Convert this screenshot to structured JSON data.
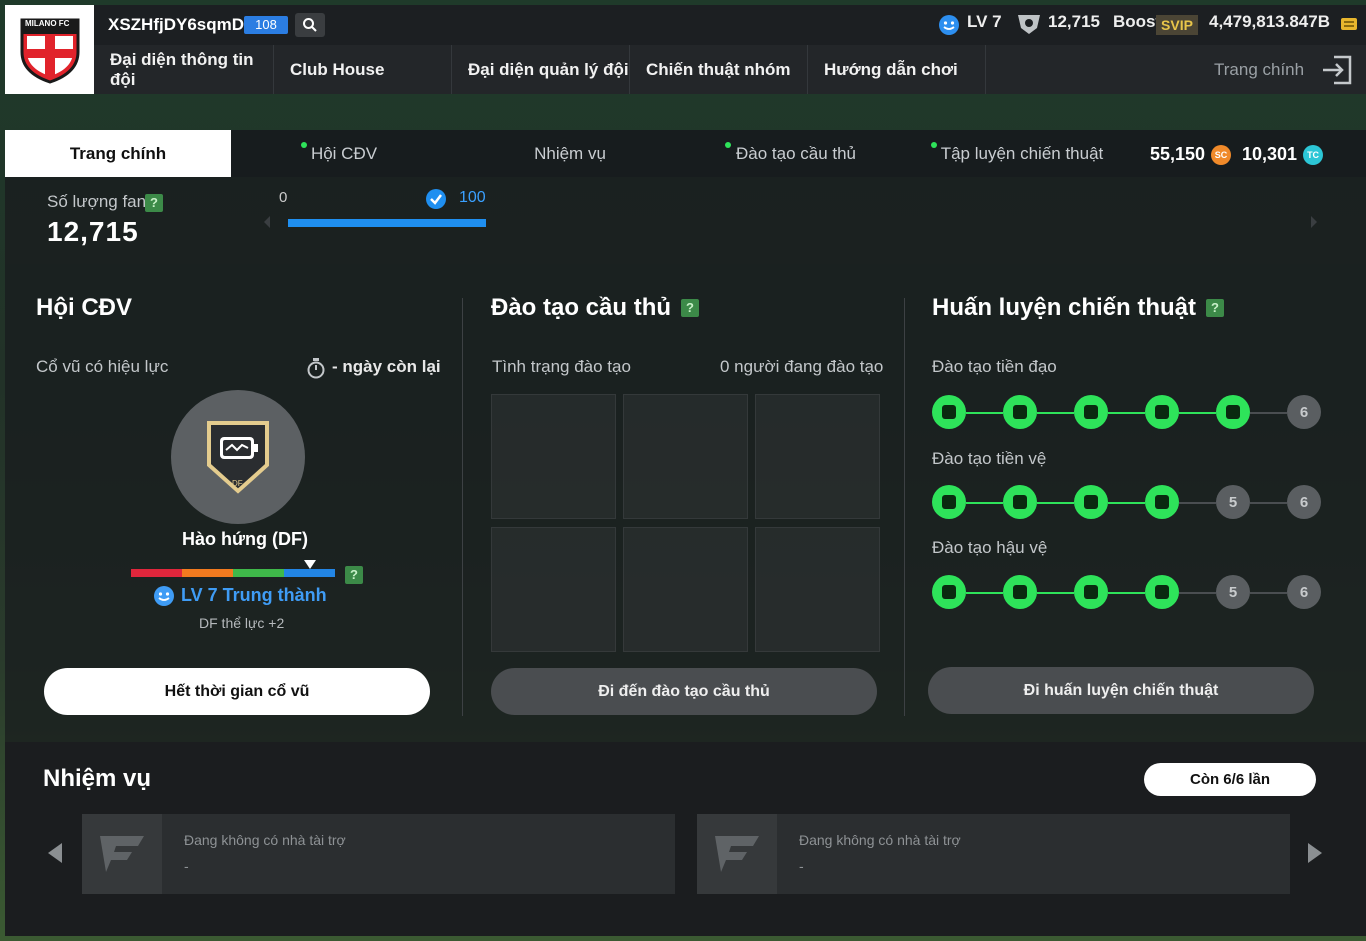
{
  "header": {
    "club_name": "XSZHfjDY6sqmDd",
    "club_badge_count": "108",
    "logo_text": "MILANO FC",
    "level": "LV 7",
    "fans": "12,715",
    "boost_label": "Boost",
    "svip_label": "SVIP",
    "balance": "4,479,813.847B"
  },
  "nav": {
    "items": [
      "Đại diện thông tin đội",
      "Club House",
      "Đại diện quản lý đội",
      "Chiến thuật nhóm",
      "Hướng dẫn chơi"
    ],
    "home": "Trang chính"
  },
  "tabs": {
    "items": [
      "Trang chính",
      "Hội CĐV",
      "Nhiệm vụ",
      "Đào tạo cầu thủ",
      "Tập luyện chiến thuật"
    ],
    "sc_amount": "55,150",
    "sc_label": "SC",
    "tc_amount": "10,301",
    "tc_label": "TC"
  },
  "fan_strip": {
    "label": "Số lượng fan",
    "help": "?",
    "count": "12,715",
    "progress_min": "0",
    "progress_max": "100",
    "progress_fraction": 1.0
  },
  "fan_club": {
    "title": "Hội CĐV",
    "active_label": "Cổ vũ có hiệu lực",
    "remaining": "- ngày còn lại",
    "badge_text": "DF",
    "status": "Hào hứng (DF)",
    "help": "?",
    "loyalty": "LV 7 Trung thành",
    "bonus": "DF thể lực +2",
    "button": "Hết thời gian cổ vũ"
  },
  "training": {
    "title": "Đào tạo cầu thủ",
    "help": "?",
    "status_label": "Tình trạng đào tạo",
    "status_value": "0 người đang đào tạo",
    "button": "Đi đến đào tạo cầu thủ"
  },
  "tactics": {
    "title": "Huấn luyện chiến thuật",
    "help": "?",
    "trees": [
      {
        "label": "Đào tạo tiền đạo",
        "active": 5,
        "nodes": [
          "",
          "",
          "",
          "",
          "",
          "6"
        ]
      },
      {
        "label": "Đào tạo tiền vệ",
        "active": 4,
        "nodes": [
          "",
          "",
          "",
          "",
          "5",
          "6"
        ]
      },
      {
        "label": "Đào tạo hậu vệ",
        "active": 4,
        "nodes": [
          "",
          "",
          "",
          "",
          "5",
          "6"
        ]
      }
    ],
    "button": "Đi huấn luyện chiến thuật"
  },
  "missions": {
    "title": "Nhiệm vụ",
    "remaining_button": "Còn 6/6 lần",
    "cards": [
      {
        "title": "Đang không có nhà tài trợ",
        "subtitle": "-"
      },
      {
        "title": "Đang không có nhà tài trợ",
        "subtitle": "-"
      }
    ]
  },
  "colors": {
    "accent_green": "#2ee35a",
    "accent_blue": "#1f8ff0",
    "loyalty_blue": "#3f9cf5"
  }
}
